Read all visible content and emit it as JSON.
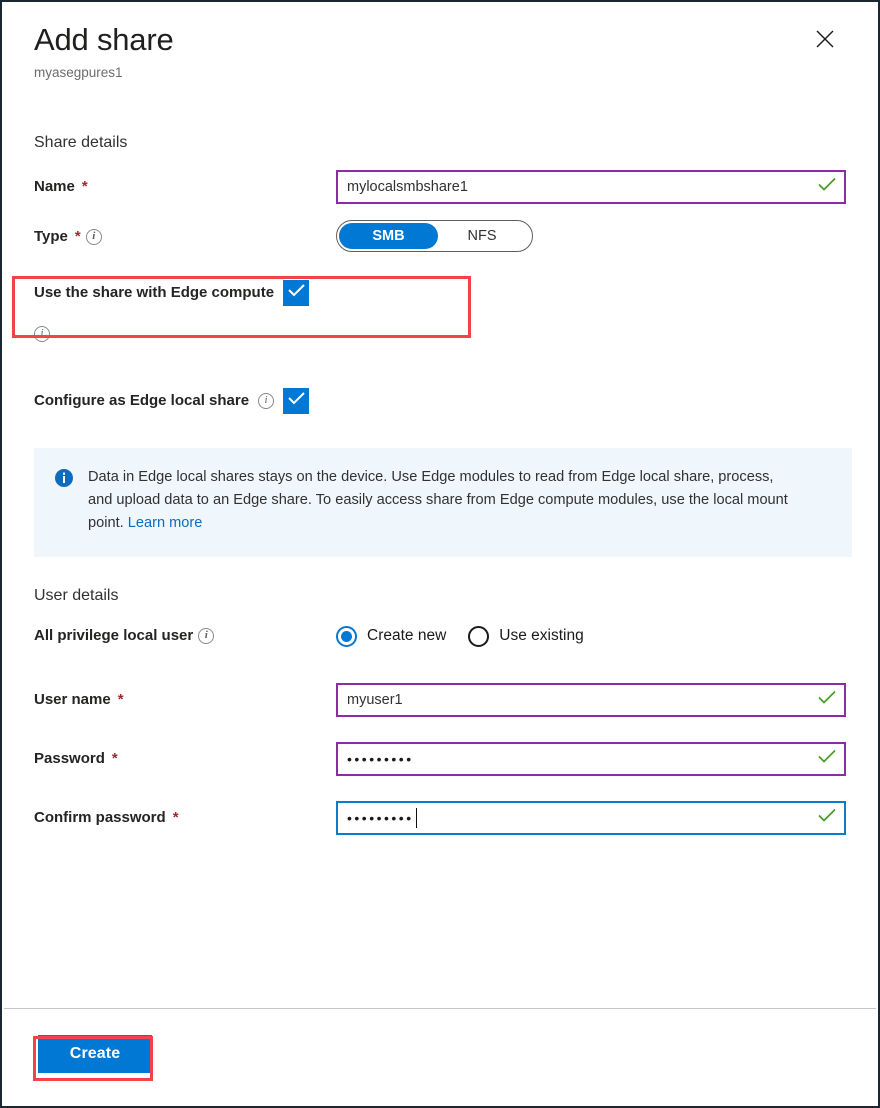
{
  "dialog": {
    "title": "Add share",
    "subtitle": "myasegpures1",
    "close_label": "Close"
  },
  "share_details": {
    "section_title": "Share details",
    "name": {
      "label": "Name",
      "required_mark": "*",
      "value": "mylocalsmbshare1",
      "placeholder": "",
      "valid": true
    },
    "type": {
      "label": "Type",
      "required_mark": "*",
      "options": [
        "SMB",
        "NFS"
      ],
      "selected": "SMB"
    },
    "edge_compute": {
      "label": "Use the share with Edge compute",
      "checked": true
    },
    "edge_local_share": {
      "label": "Configure as Edge local share",
      "checked": true
    }
  },
  "banner": {
    "text": "Data in Edge local shares stays on the device. Use Edge modules to read from Edge local share, process, and upload data to an Edge share. To easily access share from Edge compute modules, use the local mount point.",
    "link_text": "Learn more"
  },
  "user_details": {
    "section_title": "User details",
    "all_privilege_local_user": {
      "label": "All privilege local user",
      "options": [
        "Create new",
        "Use existing"
      ],
      "selected": "Create new"
    },
    "user_name": {
      "label": "User name",
      "required_mark": "*",
      "value": "myuser1",
      "valid": true
    },
    "password": {
      "label": "Password",
      "required_mark": "*",
      "masked_value": "•••••••••",
      "valid": true
    },
    "confirm_password": {
      "label": "Confirm password",
      "required_mark": "*",
      "masked_value": "•••••••••",
      "valid": true,
      "focused": true
    }
  },
  "footer": {
    "create_label": "Create"
  },
  "colors": {
    "accent_blue": "#0078d4",
    "input_border_purple": "#8a2da5",
    "focus_blue": "#0f7ac8",
    "valid_green": "#4b9b27",
    "required_red": "#a4262c",
    "annotation_red": "#f4424a",
    "banner_bg": "#eff6fc",
    "link_blue": "#0f6cbd"
  }
}
